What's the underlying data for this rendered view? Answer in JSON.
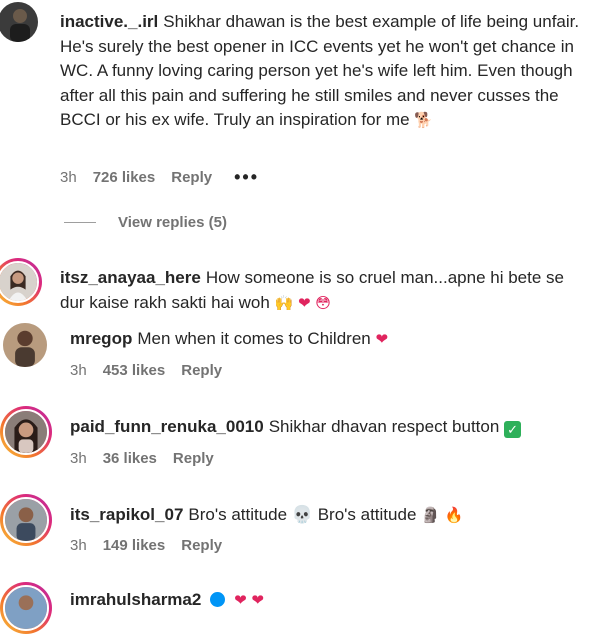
{
  "comments": [
    {
      "username": "inactive._.irl",
      "text": "Shikhar dhawan is the best example of life being unfair. He's surely the best opener in ICC events yet he won't get chance in WC. A funny loving caring person yet he's wife left him. Even though after all this pain and suffering he still smiles and never cusses the BCCI or his ex wife. Truly an inspiration for me",
      "emoji": "🐕",
      "time": "3h",
      "likes": "726 likes",
      "reply": "Reply",
      "more": "•••",
      "view_replies": "View replies (5)"
    },
    {
      "username": "itsz_anayaa_here",
      "text": "How someone is so cruel man...apne hi bete se dur kaise rakh sakti hai woh",
      "emoji": "🙌 ❤ 😳"
    },
    {
      "username": "mregop",
      "text": "Men when it comes to Children",
      "emoji": "❤",
      "time": "3h",
      "likes": "453 likes",
      "reply": "Reply"
    },
    {
      "username": "paid_funn_renuka_0010",
      "text": "Shikhar dhavan respect button",
      "emoji": "✓",
      "time": "3h",
      "likes": "36 likes",
      "reply": "Reply"
    },
    {
      "username": "its_rapikol_07",
      "text": "Bro's attitude 💀 Bro's attitude",
      "emoji": "🗿 🔥",
      "time": "3h",
      "likes": "149 likes",
      "reply": "Reply"
    },
    {
      "username": "imrahulsharma2",
      "emoji": "❤ ❤"
    }
  ],
  "colors": {
    "text": "#262626",
    "meta": "#737373",
    "heart": "#e0245e",
    "verified": "#0095f6",
    "check": "#2eb05a"
  }
}
